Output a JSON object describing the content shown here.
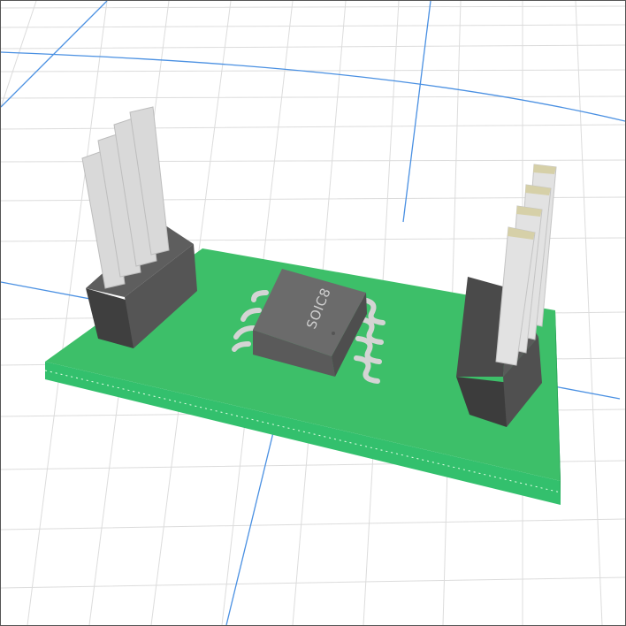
{
  "viewer": {
    "chip_label": "SOIC8"
  },
  "colors": {
    "background": "#ffffff",
    "grid_minor": "#dcdcdc",
    "grid_major": "#4a90e2",
    "board_top": "#3dbf69",
    "board_front": "#34c46e",
    "board_right": "#2aa458",
    "header_body": "#4a4a4a",
    "pin": "#d9d9d9",
    "chip_body": "#6b6b6b",
    "chip_leads": "#d4d4d4",
    "label": "#cfcfcf"
  }
}
